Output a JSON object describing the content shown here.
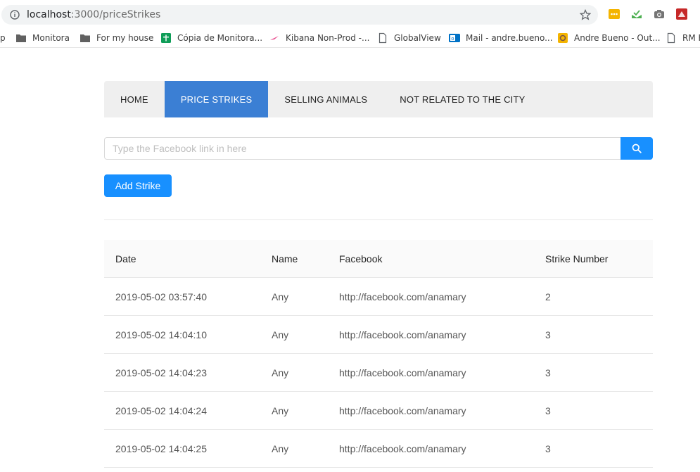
{
  "browser": {
    "url_host": "localhost",
    "url_path": ":3000/priceStrikes",
    "bookmarks": [
      {
        "label": "p",
        "icon": "none"
      },
      {
        "label": "Monitora",
        "icon": "folder-icon"
      },
      {
        "label": "For my house",
        "icon": "folder-icon"
      },
      {
        "label": "Cópia de Monitora...",
        "icon": "sheets-icon"
      },
      {
        "label": "Kibana Non-Prod -...",
        "icon": "kibana-icon"
      },
      {
        "label": "GlobalView",
        "icon": "page-icon"
      },
      {
        "label": "Mail - andre.bueno...",
        "icon": "outlook-icon"
      },
      {
        "label": "Andre Bueno - Out...",
        "icon": "outlook-yellow-icon"
      },
      {
        "label": "RM F",
        "icon": "page-icon"
      }
    ]
  },
  "nav": {
    "items": [
      {
        "label": "HOME",
        "active": false
      },
      {
        "label": "PRICE STRIKES",
        "active": true
      },
      {
        "label": "SELLING ANIMALS",
        "active": false
      },
      {
        "label": "NOT RELATED TO THE CITY",
        "active": false
      }
    ]
  },
  "search": {
    "placeholder": "Type the Facebook link in here",
    "value": ""
  },
  "actions": {
    "add_label": "Add Strike"
  },
  "table": {
    "headers": [
      "Date",
      "Name",
      "Facebook",
      "Strike Number"
    ],
    "rows": [
      [
        "2019-05-02 03:57:40",
        "Any",
        "http://facebook.com/anamary",
        "2"
      ],
      [
        "2019-05-02 14:04:10",
        "Any",
        "http://facebook.com/anamary",
        "3"
      ],
      [
        "2019-05-02 14:04:23",
        "Any",
        "http://facebook.com/anamary",
        "3"
      ],
      [
        "2019-05-02 14:04:24",
        "Any",
        "http://facebook.com/anamary",
        "3"
      ],
      [
        "2019-05-02 14:04:25",
        "Any",
        "http://facebook.com/anamary",
        "3"
      ]
    ]
  },
  "colors": {
    "accent": "#1890ff",
    "nav_active": "#3b7fd4",
    "nav_bg": "#efefef"
  }
}
